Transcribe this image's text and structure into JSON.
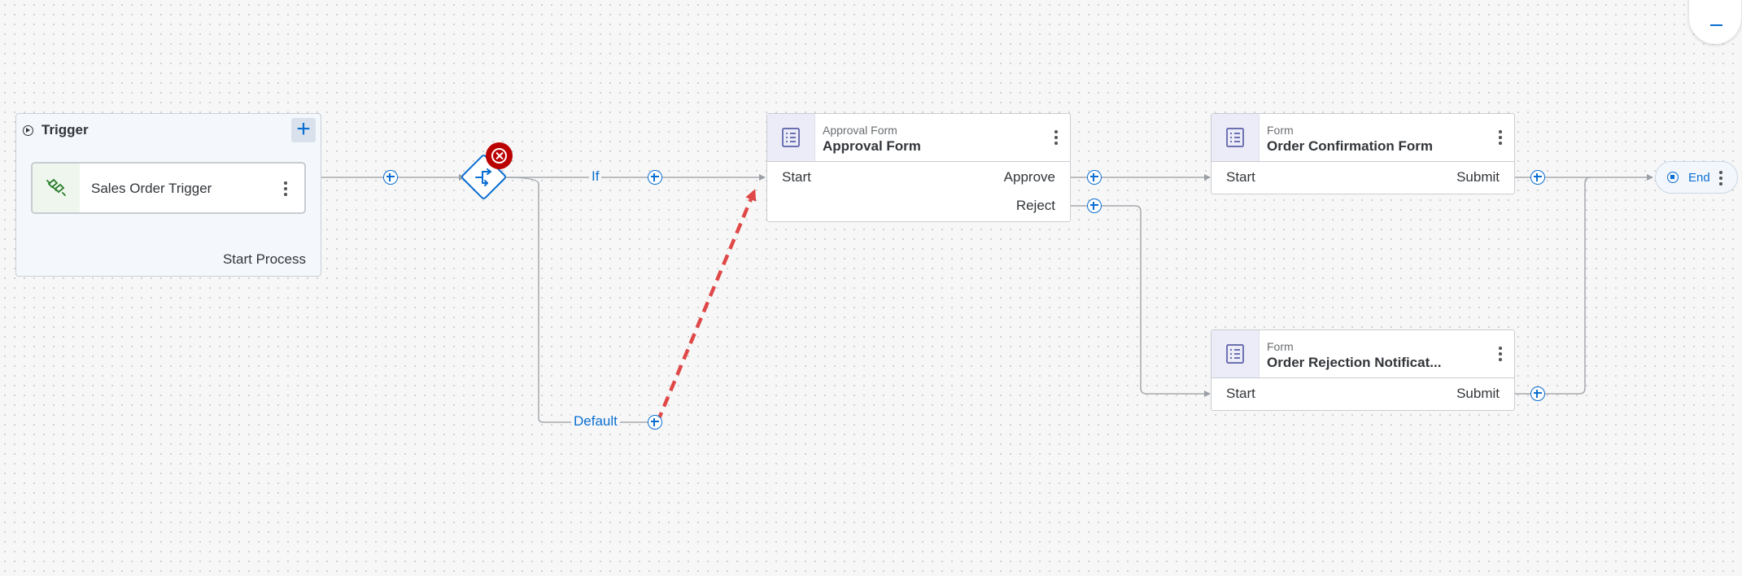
{
  "trigger": {
    "title": "Trigger",
    "event_label": "Sales Order Trigger",
    "footer_label": "Start Process"
  },
  "gateway": {
    "branches": [
      {
        "label": "If"
      },
      {
        "label": "Default"
      }
    ]
  },
  "forms": [
    {
      "subtitle": "Approval Form",
      "title": "Approval Form",
      "input": "Start",
      "outputs": [
        "Approve",
        "Reject"
      ]
    },
    {
      "subtitle": "Form",
      "title": "Order Confirmation Form",
      "input": "Start",
      "outputs": [
        "Submit"
      ]
    },
    {
      "subtitle": "Form",
      "title": "Order Rejection Notificat...",
      "input": "Start",
      "outputs": [
        "Submit"
      ]
    }
  ],
  "end": {
    "label": "End"
  },
  "colors": {
    "accent": "#0a6ed1",
    "error": "#bb0000",
    "drag_arrow": "#e04848",
    "trigger_icon": "#2b7d2b",
    "form_icon": "#5b5ea6"
  },
  "icons": {
    "trigger": "play-circle-icon",
    "event": "connector-plug-icon",
    "form": "form-list-icon",
    "gateway": "branch-arrows-icon",
    "error": "close-circle-icon",
    "end": "stop-circle-icon",
    "zoom": "minus-icon"
  }
}
